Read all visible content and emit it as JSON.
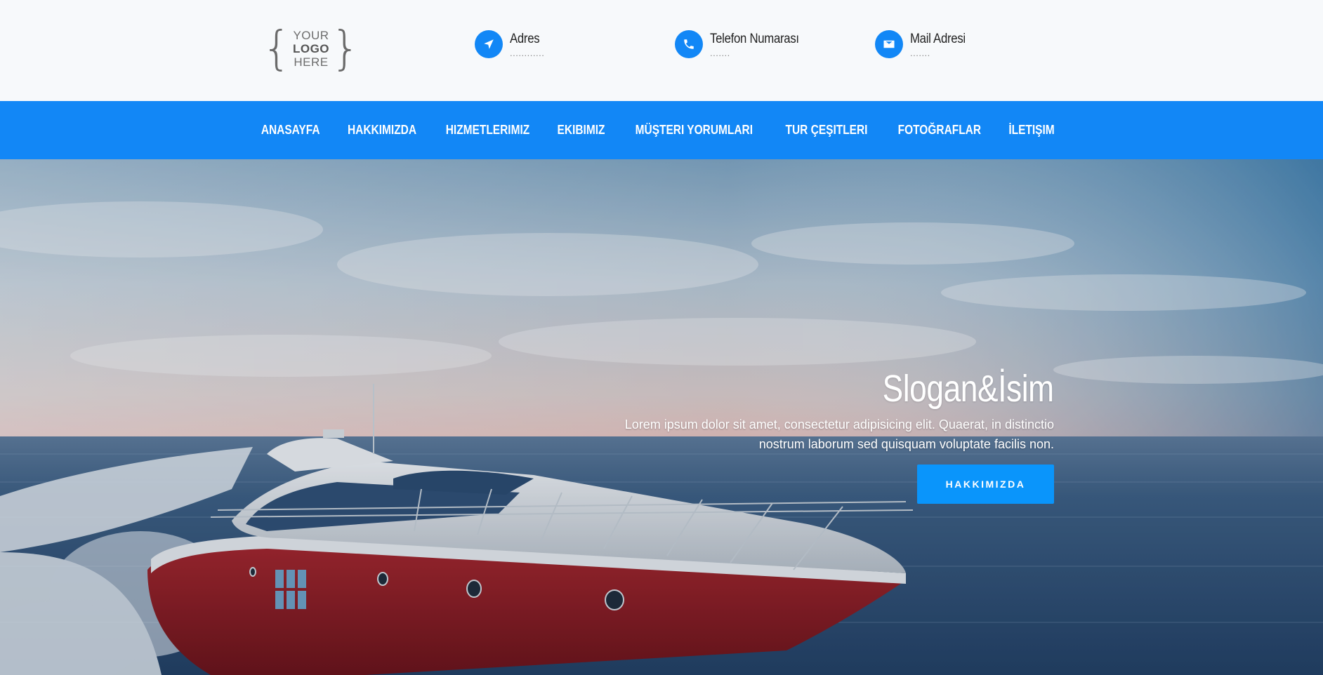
{
  "logo": {
    "line1": "YOUR",
    "line2": "LOGO",
    "line3": "HERE"
  },
  "contacts": [
    {
      "label": "Adres",
      "value": "............",
      "icon": "location-arrow-icon"
    },
    {
      "label": "Telefon Numarası",
      "value": ".......",
      "icon": "phone-icon"
    },
    {
      "label": "Mail Adresi",
      "value": ".......",
      "icon": "envelope-icon"
    }
  ],
  "nav": {
    "items": [
      "ANASAYFA",
      "HAKKIMIZDA",
      "HIZMETLERIMIZ",
      "EKIBIMIZ",
      "MÜŞTERI YORUMLARI",
      "TUR ÇEŞITLERI",
      "FOTOĞRAFLAR",
      "İLETIŞIM"
    ]
  },
  "hero": {
    "title": "Slogan&İsim",
    "text": "Lorem ipsum dolor sit amet, consectetur adipisicing elit. Quaerat, in distinctio nostrum laborum sed quisquam voluptate facilis non.",
    "button_label": "HAKKIMIZDA"
  },
  "colors": {
    "primary": "#1287f6",
    "button": "#0a95fb",
    "topbar_bg": "#f7f9fb"
  }
}
